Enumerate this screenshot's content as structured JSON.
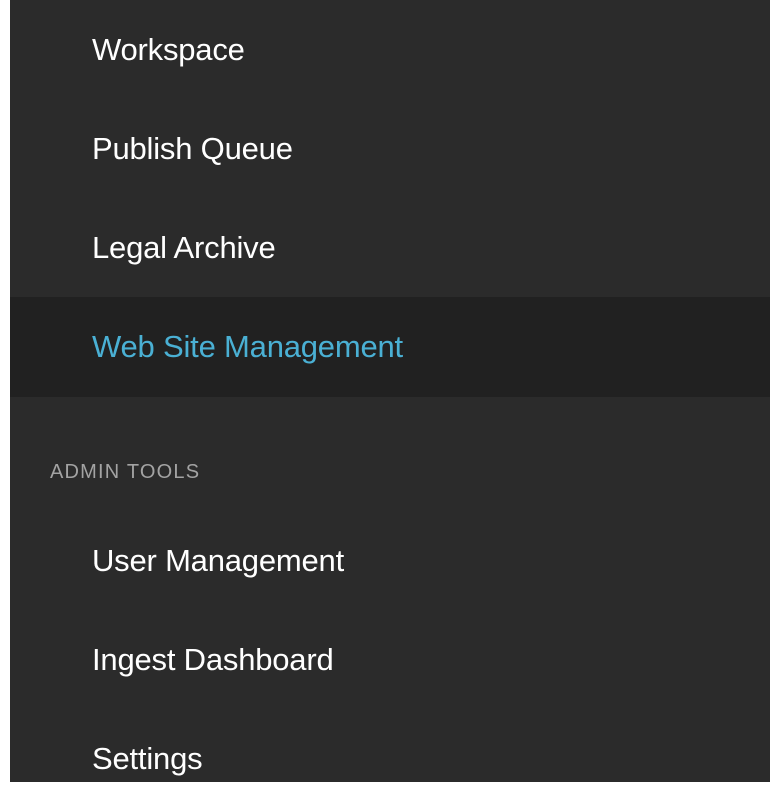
{
  "sidebar": {
    "items": [
      {
        "label": "Workspace"
      },
      {
        "label": "Publish Queue"
      },
      {
        "label": "Legal Archive"
      },
      {
        "label": "Web Site Management",
        "active": true
      }
    ],
    "admin_section": {
      "header": "ADMIN TOOLS",
      "items": [
        {
          "label": "User Management"
        },
        {
          "label": "Ingest Dashboard"
        },
        {
          "label": "Settings"
        }
      ]
    }
  },
  "colors": {
    "sidebar_background": "#2b2b2b",
    "active_background": "#212121",
    "active_text": "#4ab0d4",
    "text": "#ffffff",
    "section_header_text": "#a3a3a3"
  }
}
